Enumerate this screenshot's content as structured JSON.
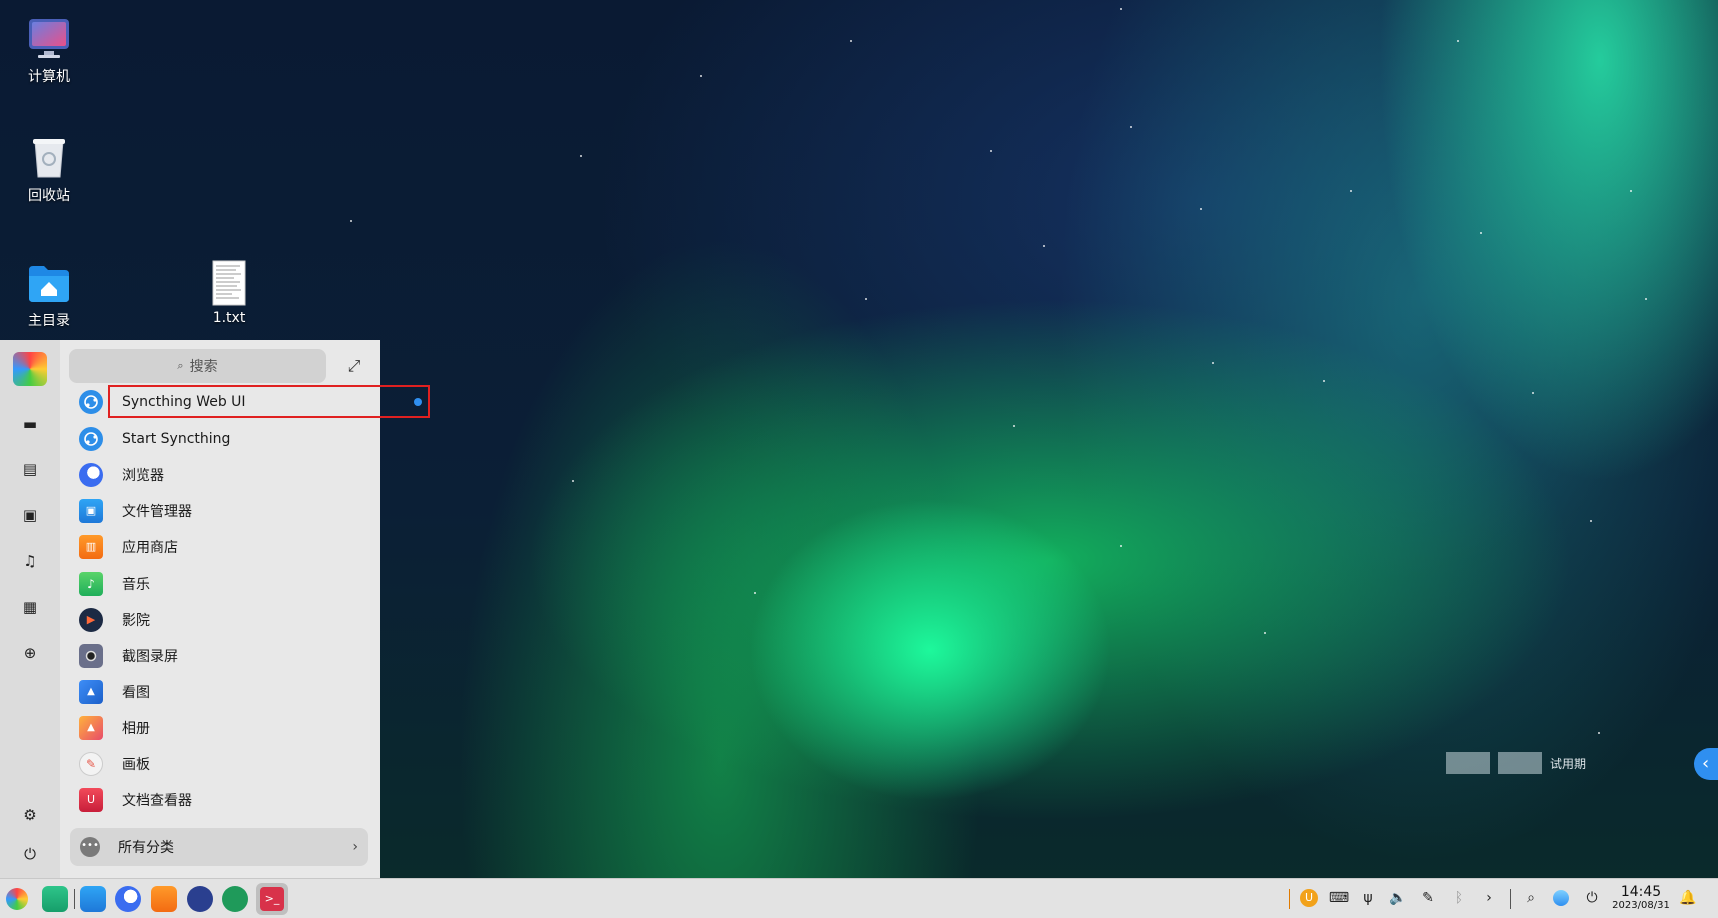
{
  "desktop": {
    "icons": [
      {
        "label": "计算机"
      },
      {
        "label": "回收站"
      },
      {
        "label": "主目录"
      },
      {
        "label": "1.txt"
      }
    ],
    "trial_label": "试用期"
  },
  "launcher": {
    "search_placeholder": "搜索",
    "apps": [
      {
        "name": "Syncthing Web UI",
        "icon": "syncthing-icon"
      },
      {
        "name": "Start Syncthing",
        "icon": "syncthing-icon"
      },
      {
        "name": "浏览器",
        "icon": "browser-icon"
      },
      {
        "name": "文件管理器",
        "icon": "file-manager-icon"
      },
      {
        "name": "应用商店",
        "icon": "app-store-icon"
      },
      {
        "name": "音乐",
        "icon": "music-icon"
      },
      {
        "name": "影院",
        "icon": "movie-icon"
      },
      {
        "name": "截图录屏",
        "icon": "screenshot-icon"
      },
      {
        "name": "看图",
        "icon": "image-viewer-icon"
      },
      {
        "name": "相册",
        "icon": "album-icon"
      },
      {
        "name": "画板",
        "icon": "draw-icon"
      },
      {
        "name": "文档查看器",
        "icon": "document-viewer-icon"
      }
    ],
    "all_categories_label": "所有分类"
  },
  "taskbar": {
    "clock": {
      "time": "14:45",
      "date": "2023/08/31"
    }
  },
  "colors": {
    "accent": "#2f8ff0",
    "highlight_border": "#e02020"
  }
}
